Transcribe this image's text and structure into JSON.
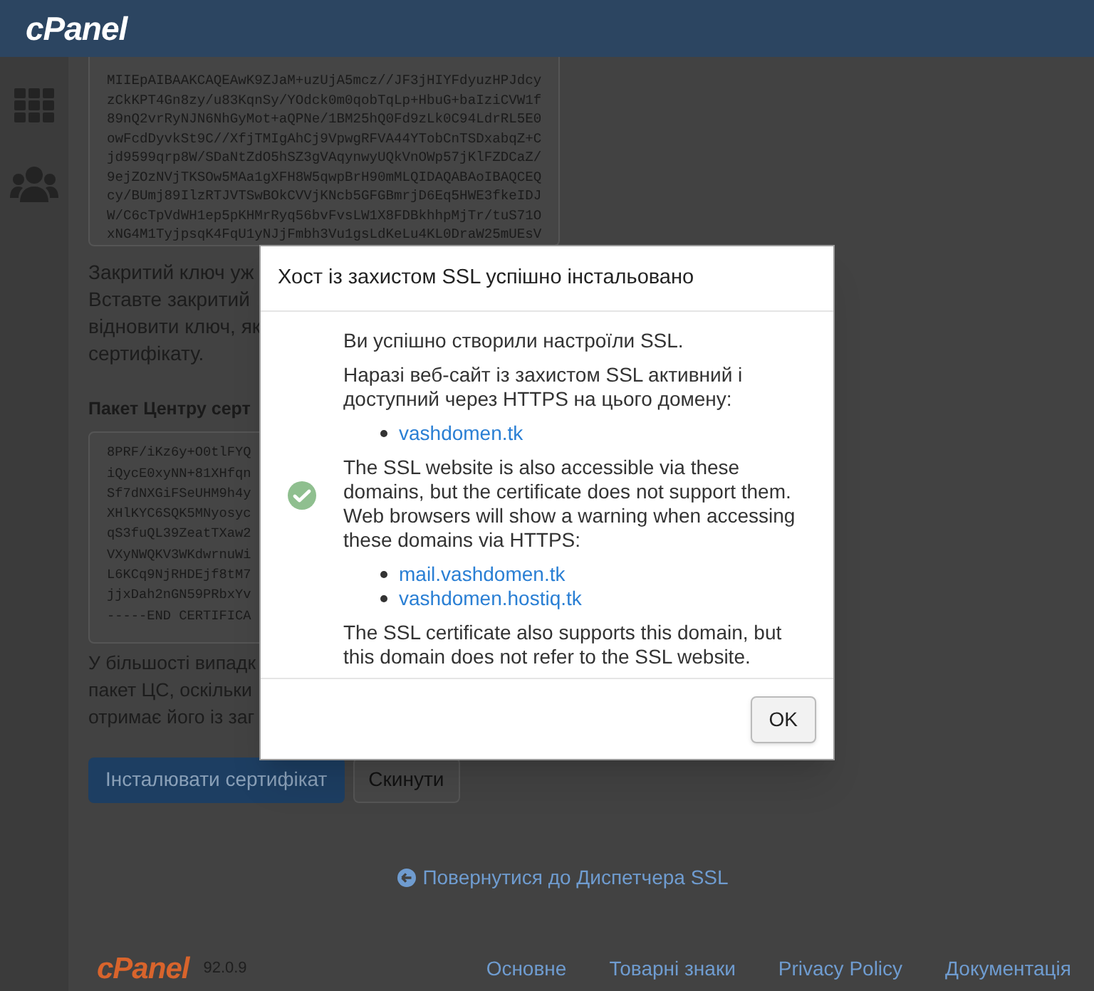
{
  "header": {
    "logo": "cPanel"
  },
  "sidebar": {
    "items": [
      {
        "kind": "grid",
        "selected": false
      },
      {
        "kind": "users",
        "selected": false
      }
    ]
  },
  "private_key": {
    "lines": [
      "MIIEpAIBAAKCAQEAwK9ZJaM+uzUjA5mcz//JF3jHIYFdyuzHPJdcy",
      "zCkKPT4Gn8zy/u83KqnSy/YOdck0m0qobTqLp+HbuG+baIziCVW1f",
      "89nQ2vrRyNJN6NhGyMot+aQPNe/1BM25hQ0Fd9zLk0C94LdrRL5E0",
      "owFcdDyvkSt9C//XfjTMIgAhCj9VpwgRFVA44YTobCnTSDxabqZ+C",
      "jd9599qrp8W/SDaNtZdO5hSZ3gVAqynwyUQkVnOWp57jKlFZDCaZ/",
      "9ejZOzNVjTKSOw5MAa1gXFH8W5qwpBrH90mMLQIDAQABAoIBAQCEQ",
      "cy/BUmj89IlzRTJVTSwBOkCVVjKNcb5GFGBmrjD6Eq5HWE3fkeIDJ",
      "W/C6cTpVdWH1ep5pKHMrRyq56bvFvsLW1X8FDBkhhpMjTr/tuS71O",
      "xNG4M1TyjpsqK4FqU1yNJjFmbh3Vu1gsLdKeLu4KL0DraW25mUEsV"
    ]
  },
  "key_note": [
    "Закритий ключ уж",
    "Вставте закритий",
    "відновити ключ, як",
    "сертифікату."
  ],
  "ca_bundle": {
    "label": "Пакет Центру серт",
    "lines": [
      "8PRF/iKz6y+O0tlFYQ",
      "iQycE0xyNN+81XHfqn",
      "Sf7dNXGiFSeUHM9h4y",
      "XHlKYC6SQK5MNyosyc",
      "qS3fuQL39ZeatTXaw2",
      "VXyNWQKV3WKdwrnuWi",
      "L6KCq9NjRHDEjf8tM7",
      "jjxDah2nGN59PRbxYv",
      "-----END CERTIFICA"
    ]
  },
  "bundle_note": [
    "У більшості випадк",
    "пакет ЦС, оскільки",
    "отримає його із заг"
  ],
  "buttons": [
    {
      "label": "Інсталювати сертифікат",
      "kind": "primary"
    },
    {
      "label": "Скинути",
      "kind": "secondary"
    }
  ],
  "back_link": "Повернутися до Диспетчера SSL",
  "footer": {
    "logo": "cPanel",
    "version": "92.0.9",
    "links": [
      "Основне",
      "Товарні знаки",
      "Privacy Policy",
      "Документація"
    ]
  },
  "dialog": {
    "title": "Хост із захистом SSL успішно інстальовано",
    "messages": [
      {
        "kind": "text",
        "text": "Ви успішно створили настроїли SSL."
      },
      {
        "kind": "text",
        "text": "Наразі веб-сайт із захистом SSL активний і доступний через HTTPS на цього домену:"
      },
      {
        "kind": "links",
        "items": [
          "vashdomen.tk"
        ]
      },
      {
        "kind": "text",
        "text": "The SSL website is also accessible via these domains, but the certificate does not support them. Web browsers will show a warning when accessing these domains via HTTPS:"
      },
      {
        "kind": "links",
        "items": [
          "mail.vashdomen.tk",
          "vashdomen.hostiq.tk"
        ]
      },
      {
        "kind": "text",
        "text": "The SSL certificate also supports this domain, but this domain does not refer to the SSL website."
      }
    ],
    "ok_button": "OK"
  }
}
